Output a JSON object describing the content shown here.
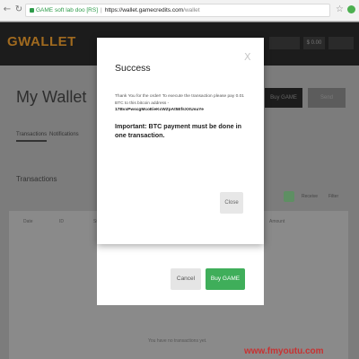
{
  "browser": {
    "site_label": "GAME soft lab doo [RS]",
    "url_host": "https://wallet.gamecredits.com",
    "url_path": "/wallet",
    "back_icon": "back-arrow-icon",
    "forward_icon": "forward-arrow-icon",
    "reload_icon": "reload-icon",
    "lock_icon": "lock-icon",
    "bookmark_icon": "star-icon",
    "extension_icon": "extension-icon"
  },
  "app": {
    "logo": "WALLET",
    "header_value": "$ 0.00",
    "page_title": "My Wallet",
    "tabs": [
      "Transactions",
      "Notifications"
    ],
    "buy_button": "Buy GAME",
    "send_button": "Send",
    "section_title": "Transactions",
    "table_headers": [
      "Date",
      "ID",
      "Status",
      "Amount"
    ],
    "empty_text": "You have no transactions yet.",
    "controls": [
      "Receive",
      "Filter"
    ]
  },
  "buy_dialog": {
    "cancel_label": "Cancel",
    "buy_label": "Buy GAME"
  },
  "success_modal": {
    "title": "Success",
    "close_glyph": "X",
    "message": "Thank You for the order! To execute the transaction please pay 0.01 BTC to this bitcoin address -",
    "address": "17BvxPwscgMcoEieKcWZpAt5EfsXXUsuYe",
    "important": "Important: BTC payment must be done in one transaction.",
    "close_button": "Close"
  },
  "watermark": "www.fmyoutu.com",
  "colors": {
    "accent_green": "#3fae5a",
    "logo_orange": "#a06a1f",
    "header_dark": "#1c1c1c",
    "overlay_gray": "#7c7c7c"
  }
}
